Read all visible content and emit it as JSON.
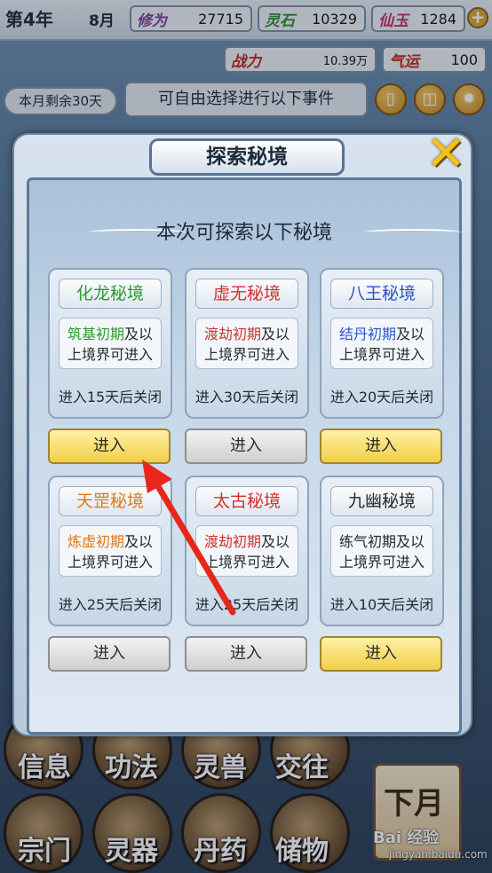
{
  "header": {
    "year": "第4年",
    "month": "8月",
    "stats": [
      {
        "label": "修为",
        "value": "27715",
        "color": "#7a3fa0"
      },
      {
        "label": "灵石",
        "value": "10329",
        "color": "#2e8a2e"
      },
      {
        "label": "仙玉",
        "value": "1284",
        "color": "#c02b6b"
      }
    ],
    "plus": "+",
    "power": {
      "label": "战力",
      "value": "10.39万",
      "color": "#c0261e"
    },
    "luck": {
      "label": "气运",
      "value": "100",
      "color": "#c0261e"
    }
  },
  "event_bar": {
    "days_left": "本月剩余30天",
    "hint": "可自由选择进行以下事件"
  },
  "modal": {
    "title": "探索秘境",
    "subtitle": "本次可探索以下秘境",
    "close_icon": "close-x-icon",
    "realms": [
      {
        "name": "化龙秘境",
        "name_color": "#2f9a2f",
        "req_highlight": "筑基初期",
        "req_color": "#2f9a2f",
        "req_rest": "及以",
        "req_line2": "上境界可进入",
        "close_text": "进入15天后关闭",
        "enter": "进入",
        "enter_style": "gold"
      },
      {
        "name": "虚无秘境",
        "name_color": "#d0342c",
        "req_highlight": "渡劫初期",
        "req_color": "#d0342c",
        "req_rest": "及以",
        "req_line2": "上境界可进入",
        "close_text": "进入30天后关闭",
        "enter": "进入",
        "enter_style": "gray"
      },
      {
        "name": "八王秘境",
        "name_color": "#2a58c4",
        "req_highlight": "结丹初期",
        "req_color": "#2a58c4",
        "req_rest": "及以",
        "req_line2": "上境界可进入",
        "close_text": "进入20天后关闭",
        "enter": "进入",
        "enter_style": "gold"
      },
      {
        "name": "天罡秘境",
        "name_color": "#e07a16",
        "req_highlight": "炼虚初期",
        "req_color": "#e07a16",
        "req_rest": "及以",
        "req_line2": "上境界可进入",
        "close_text": "进入25天后关闭",
        "enter": "进入",
        "enter_style": "gray"
      },
      {
        "name": "太古秘境",
        "name_color": "#d0342c",
        "req_highlight": "渡劫初期",
        "req_color": "#d0342c",
        "req_rest": "及以",
        "req_line2": "上境界可进入",
        "close_text": "进入25天后关闭",
        "enter": "进入",
        "enter_style": "gray"
      },
      {
        "name": "九幽秘境",
        "name_color": "#2a2a2a",
        "req_highlight": "练气初期",
        "req_color": "#2a2a2a",
        "req_rest": "及以",
        "req_line2": "上境界可进入",
        "close_text": "进入10天后关闭",
        "enter": "进入",
        "enter_style": "gold"
      }
    ]
  },
  "bottom_menu": {
    "row1": [
      "信息",
      "功法",
      "灵兽",
      "交往"
    ],
    "row2": [
      "宗门",
      "灵器",
      "丹药",
      "储物"
    ],
    "next_month": "下月"
  },
  "watermark": {
    "main": "Bai 经验",
    "sub": "jingyan.baidu.com"
  }
}
